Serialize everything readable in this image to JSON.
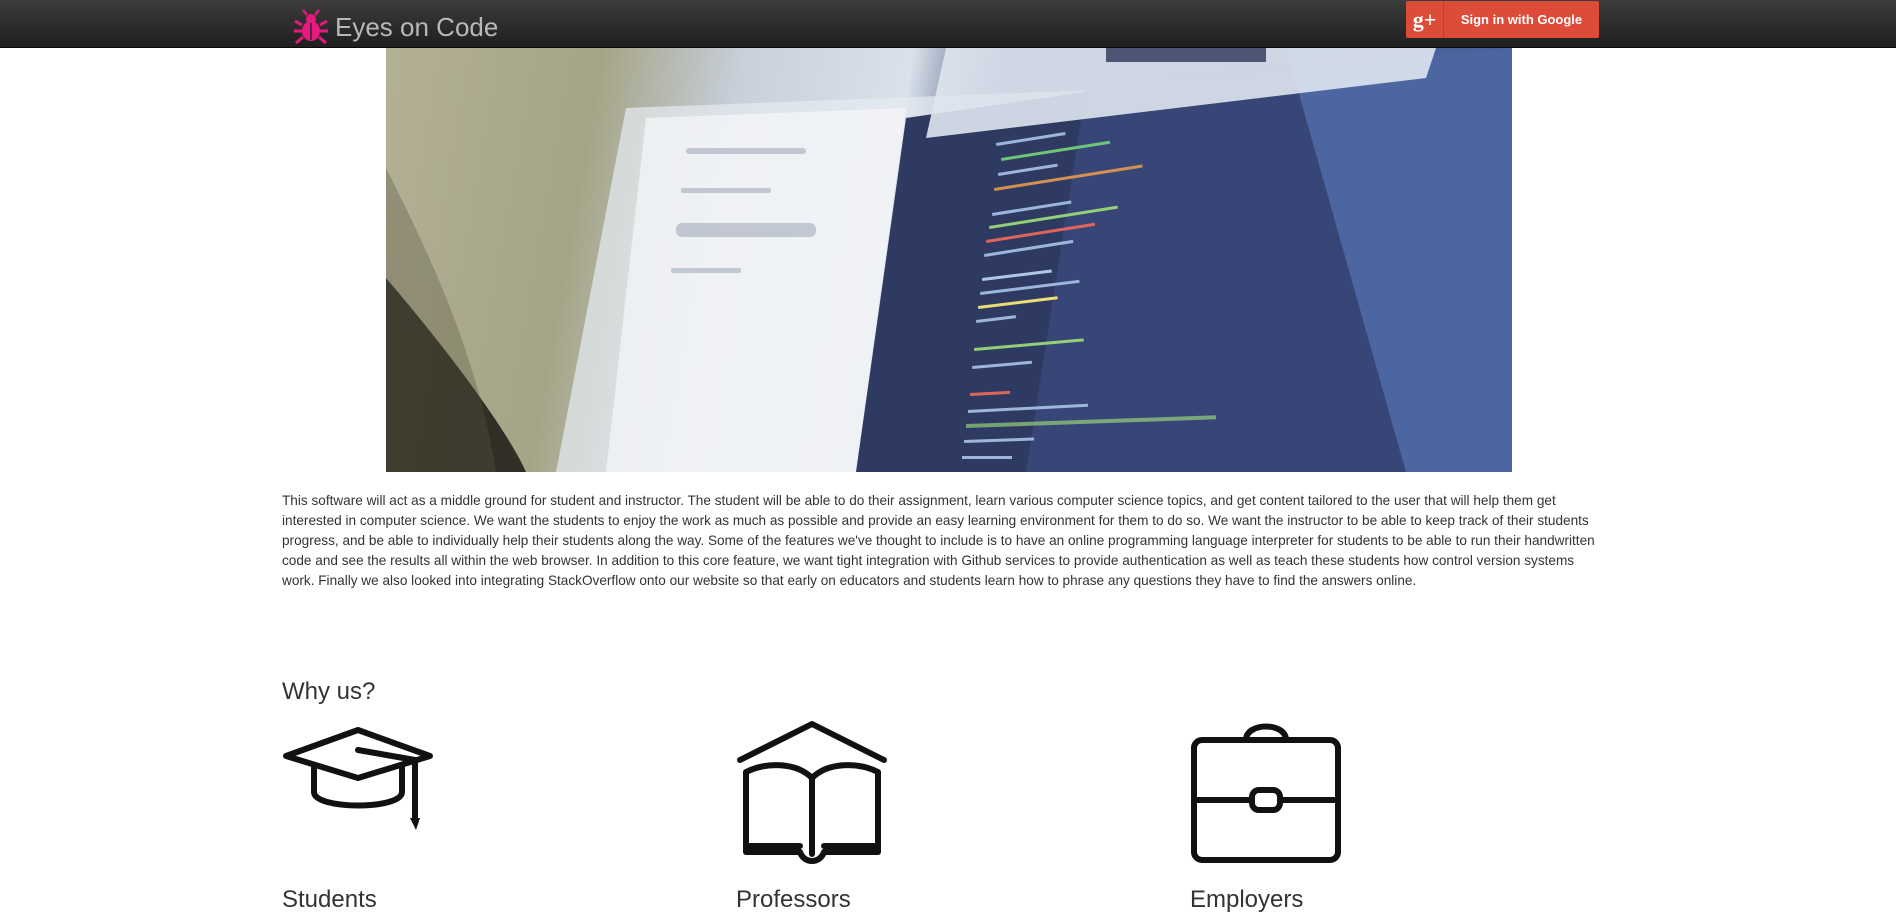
{
  "header": {
    "brand": "Eyes on Code",
    "brand_icon": "bug-icon",
    "brand_icon_color": "#e6197e",
    "signin_label": "Sign in with Google",
    "signin_icon": "google-plus-icon",
    "signin_icon_text": "g+",
    "signin_color": "#dd4b39"
  },
  "hero": {
    "image": "code-editor-photo"
  },
  "intro": {
    "text": "This software will act as a middle ground for student and instructor. The student will be able to do their assignment, learn various computer science topics, and get content tailored to the user that will help them get interested in computer science. We want the students to enjoy the work as much as possible and provide an easy learning environment for them to do so. We want the instructor to be able to keep track of their students progress, and be able to individually help their students along the way. Some of the features we've thought to include is to have an online programming language interpreter for students to be able to run their handwritten code and see the results all within the web browser. In addition to this core feature, we want tight integration with Github services to provide authentication as well as teach these students how control version systems work. Finally we also looked into integrating StackOverflow onto our website so that early on educators and students learn how to phrase any questions they have to find the answers online."
  },
  "why_us": {
    "title": "Why us?",
    "features": [
      {
        "title": "Students",
        "icon": "graduation-cap-icon"
      },
      {
        "title": "Professors",
        "icon": "open-book-icon"
      },
      {
        "title": "Employers",
        "icon": "briefcase-icon"
      }
    ]
  }
}
